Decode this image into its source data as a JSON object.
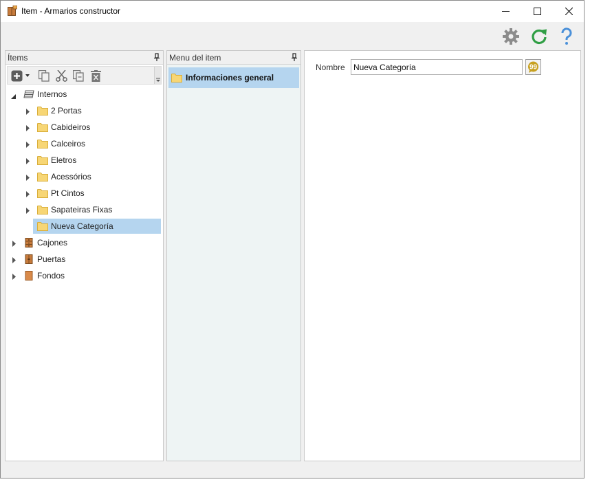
{
  "window": {
    "title": "Item - Armarios constructor"
  },
  "icons": {
    "app": "cabinet-icon",
    "minimize": "minimize-icon",
    "maximize": "maximize-icon",
    "close": "close-icon",
    "settings": "gear-icon",
    "refresh": "refresh-icon",
    "help": "help-icon"
  },
  "colors": {
    "selection": "#b5d5ef",
    "folder": "#f7d675",
    "refresh_green": "#2f9e44",
    "help_blue": "#4a90d9",
    "gear_gray": "#8c8c8c",
    "drawer_brown": "#c77b3c",
    "translate_gold": "#c7a020"
  },
  "items_panel": {
    "title": "Ítems",
    "toolbar": [
      "add-icon",
      "dropdown-icon",
      "copy-icon",
      "cut-icon",
      "paste-icon",
      "delete-icon"
    ],
    "tree": [
      {
        "label": "Internos",
        "level": 0,
        "expanded": true,
        "icon": "stack-icon"
      },
      {
        "label": "2 Portas",
        "level": 1,
        "expanded": false,
        "icon": "folder-icon"
      },
      {
        "label": "Cabideiros",
        "level": 1,
        "expanded": false,
        "icon": "folder-icon"
      },
      {
        "label": "Calceiros",
        "level": 1,
        "expanded": false,
        "icon": "folder-icon"
      },
      {
        "label": "Eletros",
        "level": 1,
        "expanded": false,
        "icon": "folder-icon"
      },
      {
        "label": "Acessórios",
        "level": 1,
        "expanded": false,
        "icon": "folder-icon"
      },
      {
        "label": "Pt Cintos",
        "level": 1,
        "expanded": false,
        "icon": "folder-icon"
      },
      {
        "label": "Sapateiras Fixas",
        "level": 1,
        "expanded": false,
        "icon": "folder-icon"
      },
      {
        "label": "Nueva Categoría",
        "level": 1,
        "selected": true,
        "icon": "folder-icon"
      },
      {
        "label": "Cajones",
        "level": 0,
        "expanded": false,
        "icon": "drawers-icon"
      },
      {
        "label": "Puertas",
        "level": 0,
        "expanded": false,
        "icon": "door-icon"
      },
      {
        "label": "Fondos",
        "level": 0,
        "expanded": false,
        "icon": "panel-icon"
      }
    ]
  },
  "menu_panel": {
    "title": "Menu del item",
    "items": [
      {
        "label": "Informaciones general",
        "selected": true,
        "icon": "folder-icon"
      }
    ]
  },
  "detail_panel": {
    "name_label": "Nombre",
    "name_value": "Nueva Categoría",
    "translate_icon": "translate-icon"
  }
}
